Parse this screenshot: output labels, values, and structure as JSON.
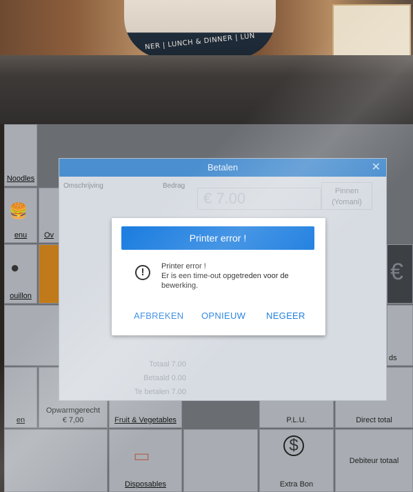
{
  "photo": {
    "cup_text": "NER | LUNCH & DINNER | LUN"
  },
  "background_tiles": {
    "noodles": "Noodles",
    "menu": "enu",
    "ov": "Ov",
    "bouillon": "ouillon",
    "en": "en",
    "opwarmen": "Opwarmgerecht",
    "opwarmen_price": "€ 7,00",
    "fruit_veg": "Fruit & Vegetables",
    "plu": "P.L.U.",
    "direct": "Direct total",
    "disposables": "Disposables",
    "extra_bon": "Extra Bon",
    "debiteur": "Debiteur totaal",
    "ds": "ds",
    "euro": "€",
    "dollar": "$"
  },
  "betalen": {
    "title": "Betalen",
    "col_description": "Omschrijving",
    "col_amount": "Bedrag",
    "amount": "€ 7.00",
    "pin_button": "Pinnen\n(Yomani)",
    "total": "Totaal 7.00",
    "paid": "Betaald 0.00",
    "to_pay": "Te betalen 7.00"
  },
  "error_dialog": {
    "title": "Printer error !",
    "line1": "Printer error !",
    "line2": "Er is een time-out opgetreden voor de",
    "line3": "bewerking.",
    "btn_cancel": "AFBREKEN",
    "btn_retry": "OPNIEUW",
    "btn_ignore": "NEGEER"
  },
  "colors": {
    "accent": "#1f7fe0",
    "title_bar": "#4b8fd0"
  }
}
